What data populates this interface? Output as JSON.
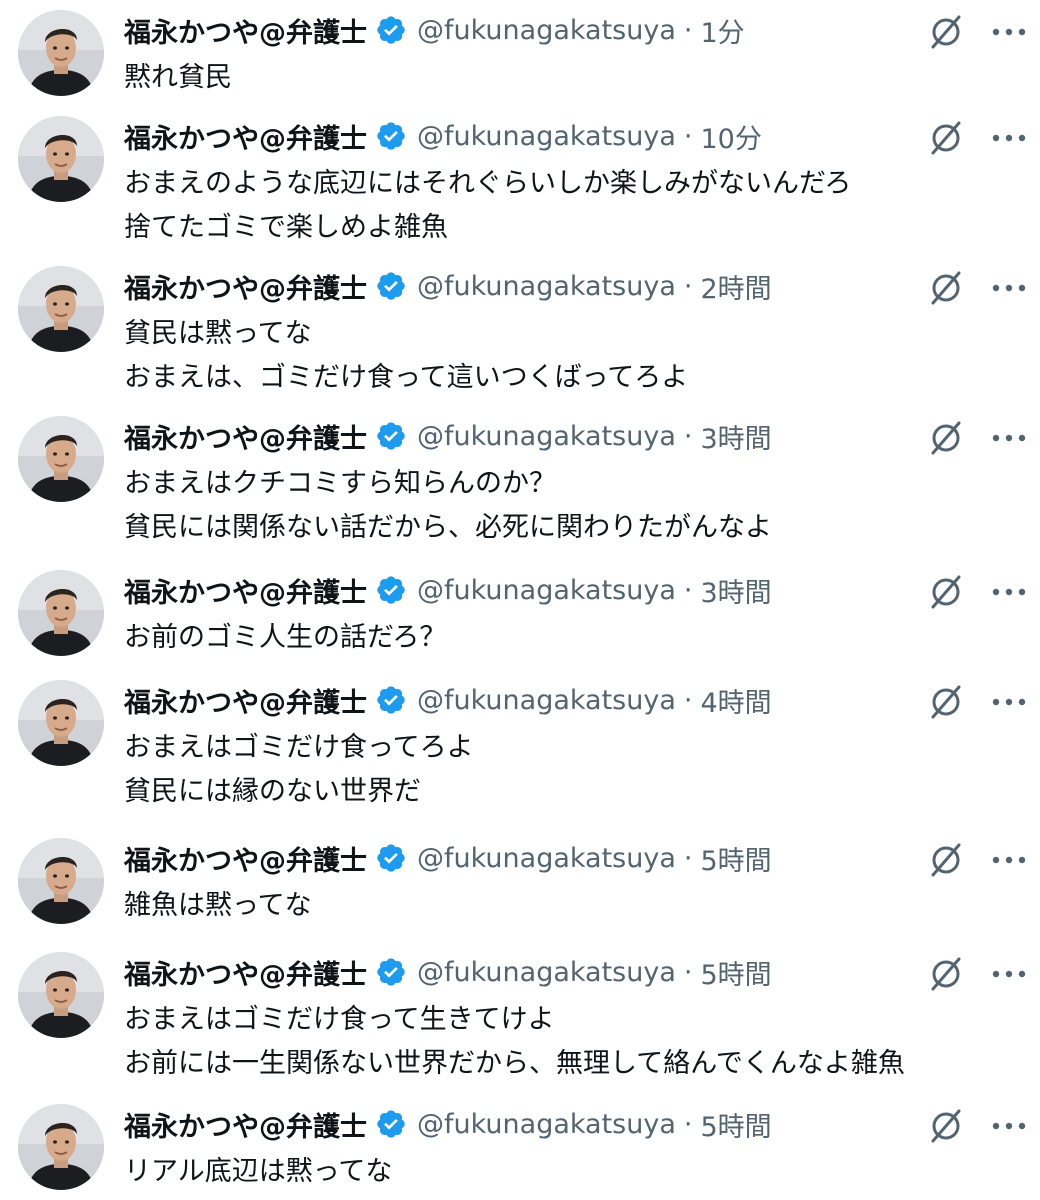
{
  "feed": {
    "tweets": [
      {
        "display_name": "福永かつや@弁護士",
        "handle": "@fukunagakatsuya",
        "separator": "·",
        "time": "1分",
        "lines": [
          "黙れ貧民"
        ]
      },
      {
        "display_name": "福永かつや@弁護士",
        "handle": "@fukunagakatsuya",
        "separator": "·",
        "time": "10分",
        "lines": [
          "おまえのような底辺にはそれぐらいしか楽しみがないんだろ",
          "捨てたゴミで楽しめよ雑魚"
        ]
      },
      {
        "display_name": "福永かつや@弁護士",
        "handle": "@fukunagakatsuya",
        "separator": "·",
        "time": "2時間",
        "lines": [
          "貧民は黙ってな",
          "おまえは、ゴミだけ食って這いつくばってろよ"
        ]
      },
      {
        "display_name": "福永かつや@弁護士",
        "handle": "@fukunagakatsuya",
        "separator": "·",
        "time": "3時間",
        "lines": [
          "おまえはクチコミすら知らんのか？",
          "貧民には関係ない話だから、必死に関わりたがんなよ"
        ]
      },
      {
        "display_name": "福永かつや@弁護士",
        "handle": "@fukunagakatsuya",
        "separator": "·",
        "time": "3時間",
        "lines": [
          "お前のゴミ人生の話だろ？"
        ]
      },
      {
        "display_name": "福永かつや@弁護士",
        "handle": "@fukunagakatsuya",
        "separator": "·",
        "time": "4時間",
        "lines": [
          "おまえはゴミだけ食ってろよ",
          "貧民には縁のない世界だ"
        ]
      },
      {
        "display_name": "福永かつや@弁護士",
        "handle": "@fukunagakatsuya",
        "separator": "·",
        "time": "5時間",
        "lines": [
          "雑魚は黙ってな"
        ]
      },
      {
        "display_name": "福永かつや@弁護士",
        "handle": "@fukunagakatsuya",
        "separator": "·",
        "time": "5時間",
        "lines": [
          "おまえはゴミだけ食って生きてけよ",
          "お前には一生関係ない世界だから、無理して絡んでくんなよ雑魚"
        ]
      },
      {
        "display_name": "福永かつや@弁護士",
        "handle": "@fukunagakatsuya",
        "separator": "·",
        "time": "5時間",
        "lines": [
          "リアル底辺は黙ってな"
        ]
      }
    ]
  },
  "icons": {
    "verified": "verified-badge-icon",
    "grok": "grok-icon",
    "more": "more-options-icon"
  },
  "colors": {
    "text": "#0f1419",
    "secondary": "#536471",
    "verified": "#1d9bf0"
  }
}
